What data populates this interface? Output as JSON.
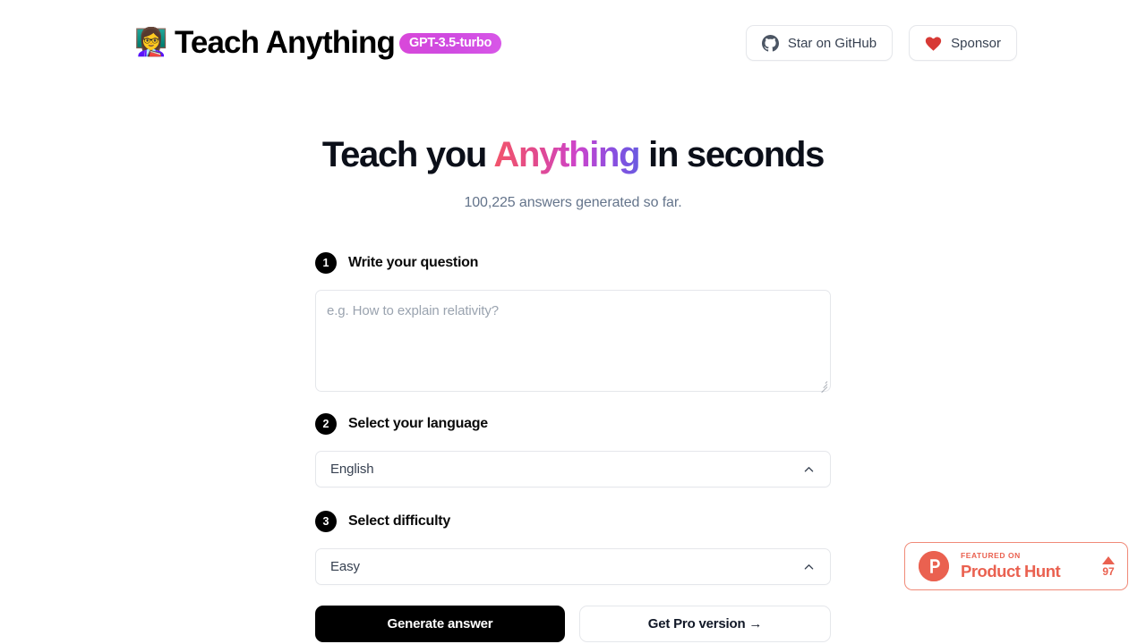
{
  "header": {
    "logo_emoji": "👩‍🏫",
    "title": "Teach Anything",
    "model_badge": "GPT-3.5-turbo",
    "github_button": "Star on GitHub",
    "sponsor_button": "Sponsor"
  },
  "hero": {
    "headline_part1": "Teach you ",
    "headline_highlight": "Anything",
    "headline_part2": " in seconds",
    "subheadline": "100,225 answers generated so far."
  },
  "form": {
    "step1": {
      "number": "1",
      "label": "Write your question",
      "placeholder": "e.g. How to explain relativity?",
      "value": ""
    },
    "step2": {
      "number": "2",
      "label": "Select your language",
      "selected": "English"
    },
    "step3": {
      "number": "3",
      "label": "Select difficulty",
      "selected": "Easy"
    },
    "generate_button": "Generate answer",
    "pro_button": "Get Pro version →"
  },
  "product_hunt": {
    "featured_on": "FEATURED ON",
    "name": "Product Hunt",
    "upvotes": "97"
  },
  "colors": {
    "accent_start": "#f2556b",
    "accent_mid": "#cc44cc",
    "accent_end": "#6a5ae0",
    "badge_gradient_start": "#d948d9",
    "badge_gradient_end": "#d857e8",
    "product_hunt": "#ea6150",
    "heart_red": "#d73a36",
    "muted_text": "#64748b",
    "border": "#e5e7eb",
    "primary_button": "#000000"
  }
}
